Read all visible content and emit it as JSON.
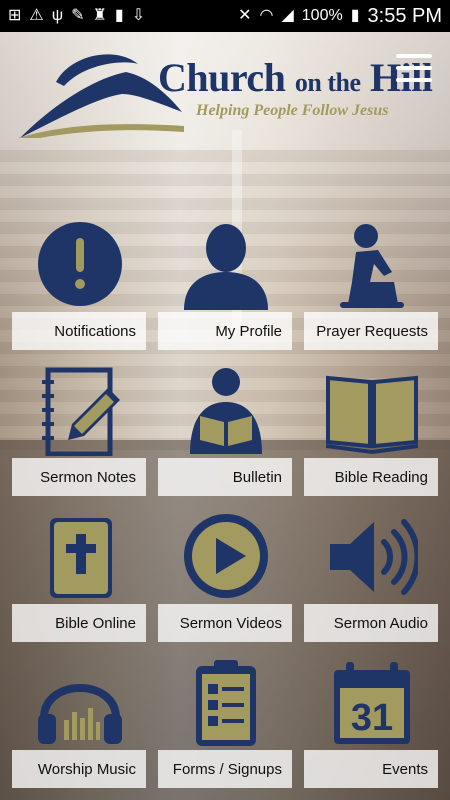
{
  "status_bar": {
    "battery": "100%",
    "time": "3:55 PM",
    "icons": [
      "plus-box-icon",
      "warning-icon",
      "usb-icon",
      "wrench-icon",
      "keyhole-icon",
      "sd-card-icon",
      "download-icon",
      "mute-icon",
      "wifi-icon",
      "signal-icon",
      "battery-icon"
    ]
  },
  "brand": {
    "title_part1": "Church",
    "title_part2": "on the",
    "title_part3": "Hill",
    "tagline": "Helping People Follow Jesus"
  },
  "colors": {
    "navy": "#1f3567",
    "gold": "#9f9650",
    "label_bg": "#ffffff"
  },
  "tiles": [
    {
      "label": "Notifications",
      "icon": "exclamation-circle-icon"
    },
    {
      "label": "My Profile",
      "icon": "person-icon"
    },
    {
      "label": "Prayer Requests",
      "icon": "praying-person-icon"
    },
    {
      "label": "Sermon Notes",
      "icon": "notebook-pencil-icon"
    },
    {
      "label": "Bulletin",
      "icon": "person-reading-icon"
    },
    {
      "label": "Bible Reading",
      "icon": "open-book-icon"
    },
    {
      "label": "Bible Online",
      "icon": "bible-cross-icon"
    },
    {
      "label": "Sermon Videos",
      "icon": "play-circle-icon"
    },
    {
      "label": "Sermon Audio",
      "icon": "speaker-icon"
    },
    {
      "label": "Worship Music",
      "icon": "headphones-icon"
    },
    {
      "label": "Forms / Signups",
      "icon": "clipboard-checklist-icon"
    },
    {
      "label": "Events",
      "icon": "calendar-icon",
      "icon_text": "31"
    }
  ]
}
